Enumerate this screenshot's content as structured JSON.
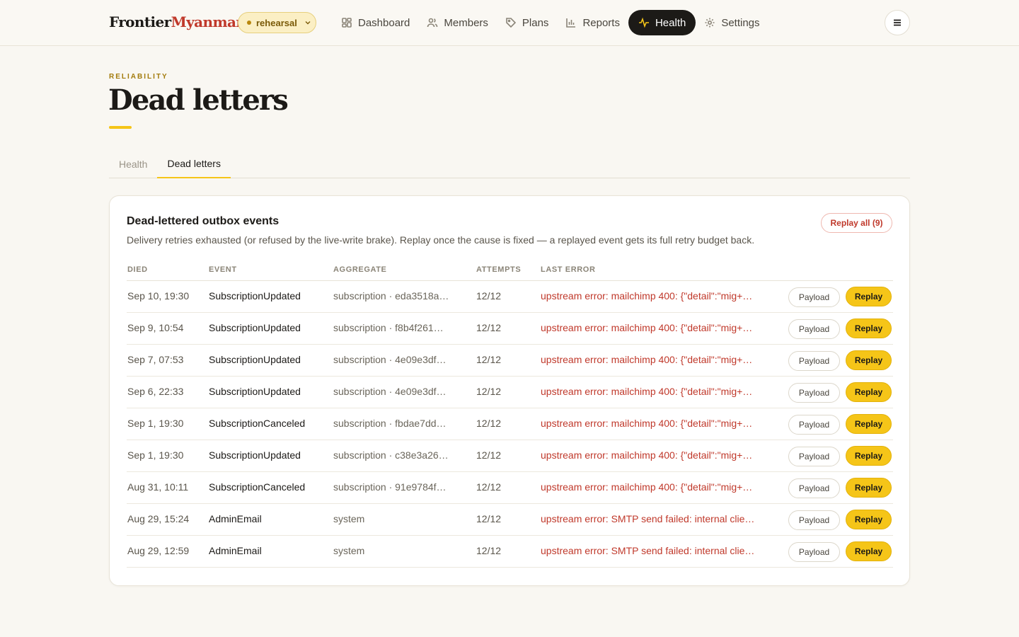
{
  "brand": {
    "part1": "Frontier",
    "part2": "Myanmar"
  },
  "env": {
    "label": "rehearsal"
  },
  "nav": [
    {
      "label": "Dashboard",
      "icon": "grid-icon"
    },
    {
      "label": "Members",
      "icon": "users-icon"
    },
    {
      "label": "Plans",
      "icon": "tag-icon"
    },
    {
      "label": "Reports",
      "icon": "bar-chart-icon"
    },
    {
      "label": "Health",
      "icon": "pulse-icon",
      "active": true
    },
    {
      "label": "Settings",
      "icon": "gear-icon"
    }
  ],
  "page": {
    "eyebrow": "RELIABILITY",
    "title": "Dead letters"
  },
  "tabs": [
    {
      "label": "Health"
    },
    {
      "label": "Dead letters",
      "active": true
    }
  ],
  "card": {
    "title": "Dead-lettered outbox events",
    "description": "Delivery retries exhausted (or refused by the live-write brake). Replay once the cause is fixed — a replayed event gets its full retry budget back.",
    "replay_all_label": "Replay all (9)"
  },
  "table": {
    "columns": [
      "DIED",
      "EVENT",
      "AGGREGATE",
      "ATTEMPTS",
      "LAST ERROR"
    ],
    "payload_label": "Payload",
    "replay_label": "Replay",
    "rows": [
      {
        "died": "Sep 10, 19:30",
        "event": "SubscriptionUpdated",
        "aggregate": "subscription · eda3518a…",
        "attempts": "12/12",
        "error": "upstream error: mailchimp 400: {\"detail\":\"mig+…"
      },
      {
        "died": "Sep 9, 10:54",
        "event": "SubscriptionUpdated",
        "aggregate": "subscription · f8b4f261…",
        "attempts": "12/12",
        "error": "upstream error: mailchimp 400: {\"detail\":\"mig+…"
      },
      {
        "died": "Sep 7, 07:53",
        "event": "SubscriptionUpdated",
        "aggregate": "subscription · 4e09e3df…",
        "attempts": "12/12",
        "error": "upstream error: mailchimp 400: {\"detail\":\"mig+…"
      },
      {
        "died": "Sep 6, 22:33",
        "event": "SubscriptionUpdated",
        "aggregate": "subscription · 4e09e3df…",
        "attempts": "12/12",
        "error": "upstream error: mailchimp 400: {\"detail\":\"mig+…"
      },
      {
        "died": "Sep 1, 19:30",
        "event": "SubscriptionCanceled",
        "aggregate": "subscription · fbdae7dd…",
        "attempts": "12/12",
        "error": "upstream error: mailchimp 400: {\"detail\":\"mig+…"
      },
      {
        "died": "Sep 1, 19:30",
        "event": "SubscriptionUpdated",
        "aggregate": "subscription · c38e3a26…",
        "attempts": "12/12",
        "error": "upstream error: mailchimp 400: {\"detail\":\"mig+…"
      },
      {
        "died": "Aug 31, 10:11",
        "event": "SubscriptionCanceled",
        "aggregate": "subscription · 91e9784f…",
        "attempts": "12/12",
        "error": "upstream error: mailchimp 400: {\"detail\":\"mig+…"
      },
      {
        "died": "Aug 29, 15:24",
        "event": "AdminEmail",
        "aggregate": "system",
        "attempts": "12/12",
        "error": "upstream error: SMTP send failed: internal clie…"
      },
      {
        "died": "Aug 29, 12:59",
        "event": "AdminEmail",
        "aggregate": "system",
        "attempts": "12/12",
        "error": "upstream error: SMTP send failed: internal clie…"
      }
    ]
  }
}
